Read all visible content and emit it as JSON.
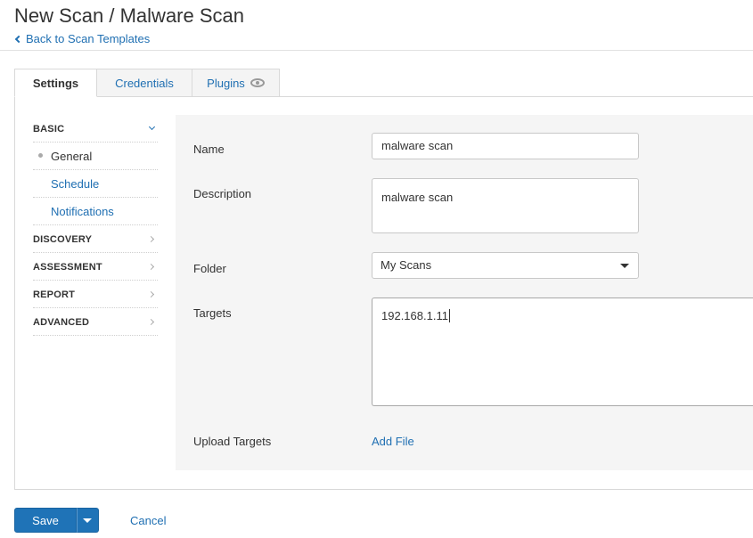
{
  "header": {
    "title": "New Scan / Malware Scan",
    "back_link": "Back to Scan Templates"
  },
  "tabs": [
    {
      "label": "Settings",
      "active": true
    },
    {
      "label": "Credentials",
      "active": false
    },
    {
      "label": "Plugins",
      "active": false,
      "icon": "eye-icon"
    }
  ],
  "sidebar": {
    "sections": [
      {
        "label": "BASIC",
        "expanded": true,
        "items": [
          {
            "label": "General",
            "current": true
          },
          {
            "label": "Schedule",
            "current": false
          },
          {
            "label": "Notifications",
            "current": false
          }
        ]
      },
      {
        "label": "DISCOVERY",
        "expanded": false
      },
      {
        "label": "ASSESSMENT",
        "expanded": false
      },
      {
        "label": "REPORT",
        "expanded": false
      },
      {
        "label": "ADVANCED",
        "expanded": false
      }
    ]
  },
  "form": {
    "name_label": "Name",
    "name_value": "malware scan",
    "description_label": "Description",
    "description_value": "malware scan",
    "folder_label": "Folder",
    "folder_value": "My Scans",
    "targets_label": "Targets",
    "targets_value": "192.168.1.11",
    "upload_label": "Upload Targets",
    "add_file": "Add File"
  },
  "actions": {
    "save_label": "Save",
    "cancel_label": "Cancel"
  },
  "colors": {
    "accent": "#1f73b7",
    "link": "#1f6fb2",
    "form_bg": "#f5f5f5"
  }
}
